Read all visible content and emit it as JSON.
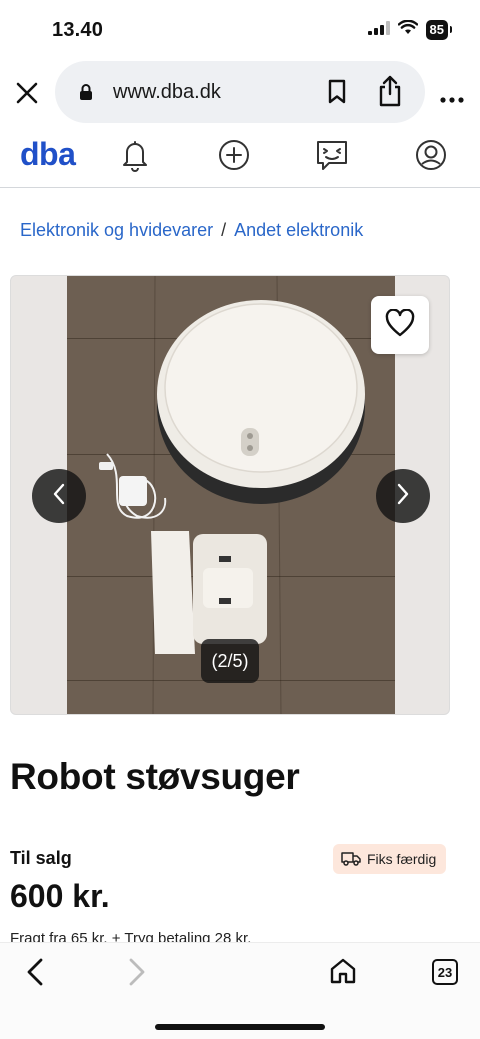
{
  "status_bar": {
    "time": "13.40",
    "battery": "85"
  },
  "browser": {
    "url": "www.dba.dk"
  },
  "site": {
    "logo": "dba"
  },
  "breadcrumb": {
    "first": "Elektronik og hvidevarer",
    "separator": "/",
    "second": "Andet elektronik"
  },
  "gallery": {
    "counter": "(2/5)"
  },
  "listing": {
    "title": "Robot støvsuger",
    "sale_type": "Til salg",
    "badge": "Fiks færdig",
    "price": "600 kr.",
    "shipping": "Fragt fra 65 kr. + Tryg betaling 28 kr."
  },
  "bottom_bar": {
    "tab_count": "23"
  },
  "colors": {
    "brand": "#2050c8",
    "link": "#2a67c9",
    "badge_bg": "#fde7dc"
  }
}
